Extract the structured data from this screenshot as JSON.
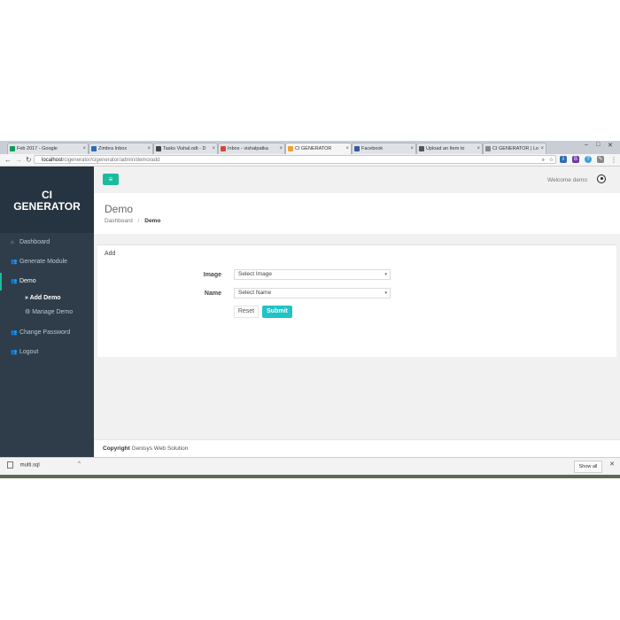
{
  "browser": {
    "tabs": [
      {
        "label": "Feb 2017 - Google",
        "color": "#0f9d58"
      },
      {
        "label": "Zimbra Inbox",
        "color": "#2a6fb0"
      },
      {
        "label": "Tasks Vishal.odt - D",
        "color": "#444444"
      },
      {
        "label": "Inbox - vishalpatka",
        "color": "#d44638"
      },
      {
        "label": "CI GENERATOR",
        "color": "#f0a030"
      },
      {
        "label": "Facebook",
        "color": "#3b5998"
      },
      {
        "label": "Upload an Item to",
        "color": "#555555"
      },
      {
        "label": "CI GENERATOR | Lo",
        "color": "#888888"
      }
    ],
    "tab_close": "×",
    "window_controls": [
      "–",
      "□",
      "✕"
    ],
    "url_host": "localhost",
    "url_path": "/cigenerator/cigenerator/admin/demo/add",
    "extensions": [
      "B",
      "?",
      "◎"
    ]
  },
  "sidebar": {
    "brand_line1": "CI",
    "brand_line2": "GENERATOR",
    "items": [
      {
        "label": "Dashboard",
        "icon": "⌂"
      },
      {
        "label": "Generate Module",
        "icon": "👥"
      },
      {
        "label": "Demo",
        "icon": "👥"
      },
      {
        "label": "Change Password",
        "icon": "👥"
      },
      {
        "label": "Logout",
        "icon": "👥"
      }
    ],
    "sub_items": [
      {
        "label": "» Add Demo"
      },
      {
        "label": "⚙ Manage Demo"
      }
    ]
  },
  "topbar": {
    "menu_icon": "≡",
    "welcome": "Welcome demo"
  },
  "page": {
    "title": "Demo",
    "breadcrumb_root": "Dashboard",
    "breadcrumb_sep": "/",
    "breadcrumb_current": "Demo"
  },
  "form": {
    "card_title": "Add",
    "image_label": "Image",
    "image_value": "Select Image",
    "name_label": "Name",
    "name_value": "Select Name",
    "caret": "▾",
    "reset_label": "Reset",
    "submit_label": "Submit"
  },
  "footer": {
    "copyright_bold": "Copyright",
    "company": "Genisys Web Solution"
  },
  "downloads": {
    "file": "multi.sql",
    "caret": "^",
    "show_all": "Show all",
    "close": "✕"
  },
  "colors": {
    "accent": "#1abc9c",
    "submit": "#20c4c4",
    "sidebar": "#2f3d4a"
  }
}
